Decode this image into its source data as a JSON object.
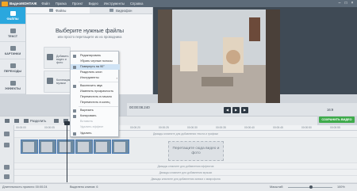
{
  "titlebar": {
    "app_title": "ВидеоМОНТАЖ",
    "menu": [
      "Файл",
      "Правка",
      "Проект",
      "Видео",
      "Инструменты",
      "Справка"
    ]
  },
  "sidebar": {
    "items": [
      {
        "label": "ФАЙЛЫ",
        "icon": "folder-icon"
      },
      {
        "label": "ТЕКСТ",
        "icon": "text-icon"
      },
      {
        "label": "КАРТИНКИ",
        "icon": "picture-icon"
      },
      {
        "label": "ПЕРЕХОДЫ",
        "icon": "transitions-icon"
      },
      {
        "label": "ЭФФЕКТЫ",
        "icon": "effects-icon"
      }
    ]
  },
  "media": {
    "tabs": [
      "Файлы",
      "Видеофон"
    ],
    "title": "Выберите нужные файлы",
    "subtitle": "или просто перетащите их из проводника",
    "tile_add": "Добавить видео и фото",
    "tile_music": "Коллекция музыки"
  },
  "preview": {
    "timecode": "00:00:08.240",
    "ratio": "16:9",
    "save_label": "СОХРАНИТЬ ВИДЕО"
  },
  "toolbar": {
    "split_label": "Разделить"
  },
  "ruler": {
    "ticks": [
      "00:00:00",
      "00:00:05",
      "00:00:10",
      "00:00:15",
      "00:00:20",
      "00:00:25",
      "00:00:30",
      "00:00:35",
      "00:00:40",
      "00:00:45",
      "00:00:50",
      "00:00:55"
    ]
  },
  "timeline": {
    "text_hint": "Дважды кликните для добавления текста и графики",
    "drop_zone": "Перетащите сюда видео и фото",
    "effects_hint": "Дважды кликните для добавления эффектов",
    "music_hint": "Дважды кликните для добавления музыки",
    "voice_hint": "Дважды кликните для добавления записи с микрофона"
  },
  "status": {
    "duration": "Длительность проекта: 00:00:24",
    "selected": "Выделено клипов: 6",
    "zoom_label": "Масштаб:",
    "zoom_value": "100%"
  },
  "context_menu": {
    "items": [
      "Редактировать",
      "Убрать черные полосы",
      "Повернуть на 90°",
      "Разделить клип",
      "Инструменты",
      "Выключить звук",
      "Изменить прозрачность",
      "Переместить в начало",
      "Переместить в конец",
      "Вырезать",
      "Копировать",
      "Вставить",
      "Удалить эффект",
      "Удалить"
    ]
  },
  "colors": {
    "accent": "#2aa7de",
    "save": "#3eab4b",
    "titlebar": "#5d6b79"
  }
}
